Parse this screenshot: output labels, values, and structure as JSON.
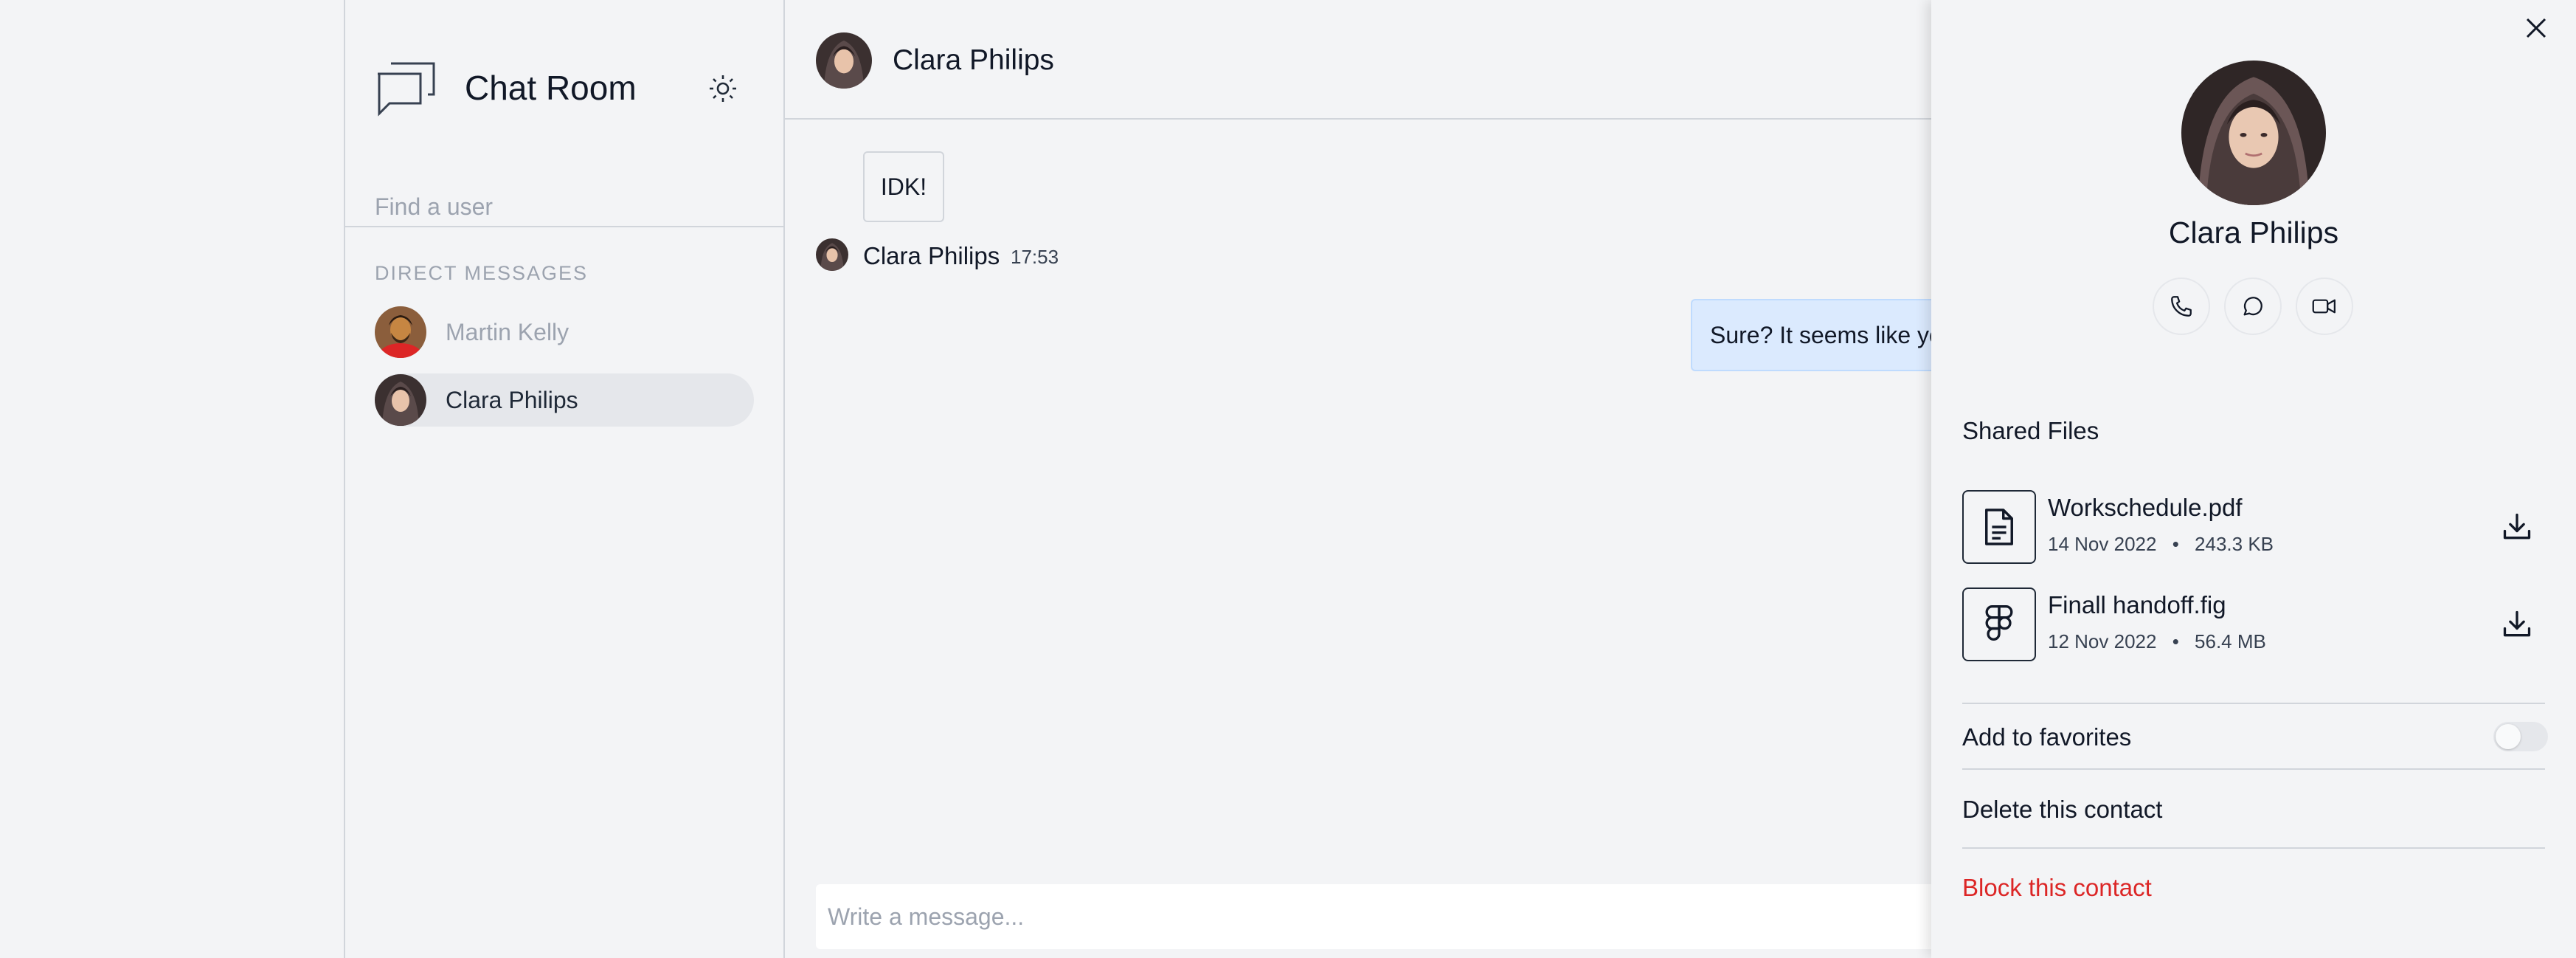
{
  "app": {
    "title": "Chat Room"
  },
  "sidebar": {
    "search_placeholder": "Find a user",
    "section_title": "DIRECT MESSAGES",
    "items": [
      {
        "name": "Martin Kelly",
        "active": false
      },
      {
        "name": "Clara Philips",
        "active": true
      }
    ]
  },
  "chat": {
    "contact_name": "Clara Philips",
    "messages": [
      {
        "text": "IDK!",
        "sender": "Clara Philips",
        "time": "17:53"
      },
      {
        "text": "Sure? It seems like yo",
        "outgoing": true
      }
    ],
    "composer_placeholder": "Write a message..."
  },
  "panel": {
    "name": "Clara Philips",
    "actions": [
      "phone-icon",
      "chat-bubble-icon",
      "video-camera-icon"
    ],
    "shared_files_title": "Shared Files",
    "files": [
      {
        "name": "Workschedule.pdf",
        "date": "14 Nov 2022",
        "size": "243.3 KB",
        "icon": "document-icon"
      },
      {
        "name": "Finall handoff.fig",
        "date": "12 Nov 2022",
        "size": "56.4 MB",
        "icon": "figma-icon"
      }
    ],
    "favorites_label": "Add to favorites",
    "favorites_enabled": false,
    "delete_label": "Delete this contact",
    "block_label": "Block this contact"
  },
  "colors": {
    "background": "#f3f4f6",
    "outgoing_bubble": "#dbeafe",
    "danger": "#dc2626",
    "muted_text": "#9ca3af"
  }
}
